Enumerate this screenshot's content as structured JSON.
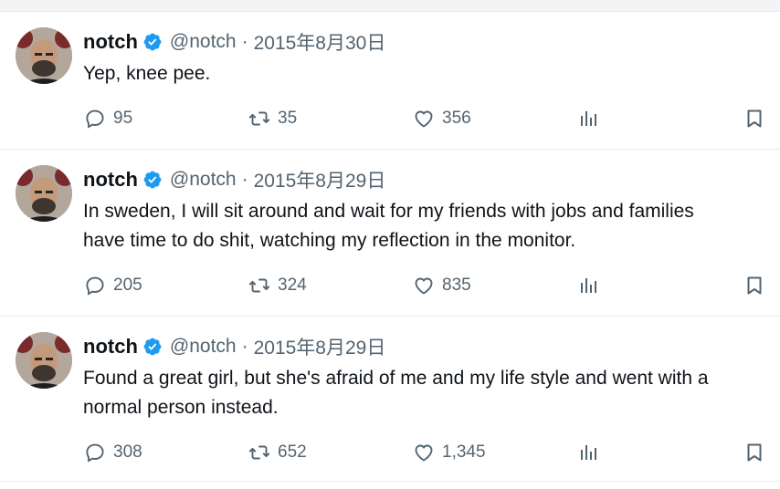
{
  "tweets": [
    {
      "name": "notch",
      "handle": "@notch",
      "separator": "·",
      "date": "2015年8月30日",
      "text": "Yep, knee pee.",
      "replies": "95",
      "retweets": "35",
      "likes": "356"
    },
    {
      "name": "notch",
      "handle": "@notch",
      "separator": "·",
      "date": "2015年8月29日",
      "text": "In sweden, I will sit around and wait for my friends with jobs and families\nhave time to do shit, watching my reflection in the monitor.",
      "replies": "205",
      "retweets": "324",
      "likes": "835"
    },
    {
      "name": "notch",
      "handle": "@notch",
      "separator": "·",
      "date": "2015年8月29日",
      "text": "Found a great girl, but she's afraid of me and my life style and went with a\nnormal person instead.",
      "replies": "308",
      "retweets": "652",
      "likes": "1,345"
    }
  ],
  "colors": {
    "verified_blue": "#1d9bf0",
    "secondary_text": "#536471",
    "primary_text": "#0f1419"
  },
  "icons": {
    "verified": "verified-badge-icon",
    "reply": "reply-icon",
    "retweet": "retweet-icon",
    "like": "heart-icon",
    "views": "views-chart-icon",
    "bookmark": "bookmark-icon"
  }
}
